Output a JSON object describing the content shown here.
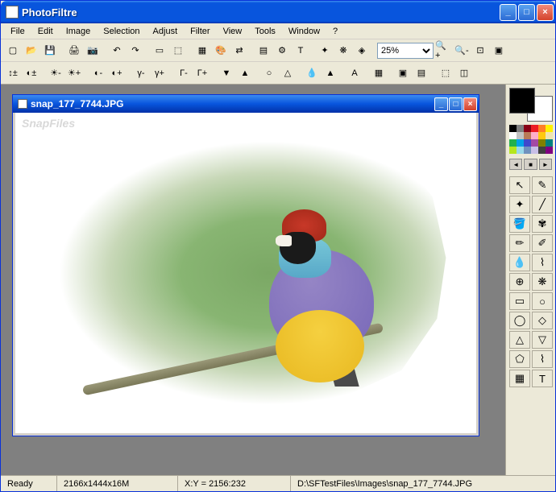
{
  "app": {
    "title": "PhotoFiltre"
  },
  "menus": [
    "File",
    "Edit",
    "Image",
    "Selection",
    "Adjust",
    "Filter",
    "View",
    "Tools",
    "Window",
    "?"
  ],
  "toolbar1": {
    "zoom_value": "25%",
    "buttons": [
      "new",
      "open",
      "save",
      "",
      "print",
      "twain",
      "",
      "undo",
      "redo",
      "",
      "rect-sel",
      "fit",
      "",
      "color-mode",
      "palette",
      "swap",
      "",
      "layers",
      "image-opts",
      "text",
      "",
      "filters1",
      "filters2",
      "filters3"
    ]
  },
  "toolbar2_buttons": [
    "auto-levels",
    "auto-contrast",
    "",
    "bright-minus",
    "bright-plus",
    "",
    "contrast-minus",
    "contrast-plus",
    "",
    "corr-minus",
    "corr-plus",
    "",
    "gamma-minus",
    "gamma-plus",
    "",
    "sat-minus",
    "sat-plus",
    "",
    "blur",
    "sharpen",
    "",
    "drop",
    "triangle",
    "",
    "text-tool",
    "",
    "hue",
    "",
    "mode1",
    "mode2",
    "",
    "mode3",
    "mode4"
  ],
  "document": {
    "title": "snap_177_7744.JPG",
    "watermark": "SnapFiles"
  },
  "colors": {
    "foreground": "#000000",
    "background": "#ffffff"
  },
  "palette_colors": [
    [
      "#000000",
      "#7f7f7f",
      "#880015",
      "#ed1c24",
      "#ff7f27",
      "#fff200"
    ],
    [
      "#ffffff",
      "#c3c3c3",
      "#b97a57",
      "#ffaec9",
      "#ffc90e",
      "#efe4b0"
    ],
    [
      "#22b14c",
      "#00a2e8",
      "#3f48cc",
      "#a349a4",
      "#808000",
      "#008080"
    ],
    [
      "#b5e61d",
      "#99d9ea",
      "#7092be",
      "#c8bfe7",
      "#404040",
      "#800080"
    ]
  ],
  "tools": [
    "pointer",
    "picker",
    "wand",
    "line",
    "bucket",
    "spray",
    "brush",
    "brush2",
    "drop",
    "smudge",
    "stamp",
    "pattern",
    "rect",
    "circle",
    "rounded",
    "diamond",
    "triangle",
    "triangle2",
    "poly",
    "lasso",
    "grid",
    "text"
  ],
  "status": {
    "ready": "Ready",
    "dimensions": "2166x1444x16M",
    "coords": "X:Y = 2156:232",
    "path": "D:\\SFTestFiles\\Images\\snap_177_7744.JPG"
  }
}
